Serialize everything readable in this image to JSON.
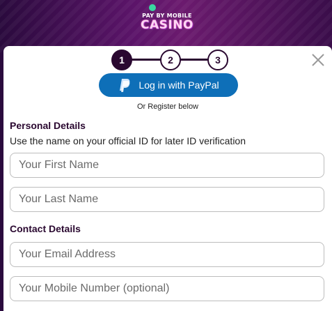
{
  "logo": {
    "top_text": "PAY BY MOBILE",
    "main_text": "CASINO"
  },
  "stepper": {
    "steps": [
      "1",
      "2",
      "3"
    ],
    "active_step": 1
  },
  "paypal": {
    "label": "Log in with PayPal"
  },
  "register_text": "Or Register below",
  "personal": {
    "title": "Personal Details",
    "hint": "Use the name on your official ID for later ID verification",
    "first_name_placeholder": "Your First Name",
    "last_name_placeholder": "Your Last Name"
  },
  "contact": {
    "title": "Contact Details",
    "email_placeholder": "Your Email Address",
    "mobile_placeholder": "Your Mobile Number (optional)"
  },
  "colors": {
    "accent_dark": "#2a0830",
    "paypal_blue": "#0e6fb8",
    "background": "#5b1469"
  },
  "icons": {
    "close": "close-icon",
    "paypal": "paypal-icon"
  }
}
